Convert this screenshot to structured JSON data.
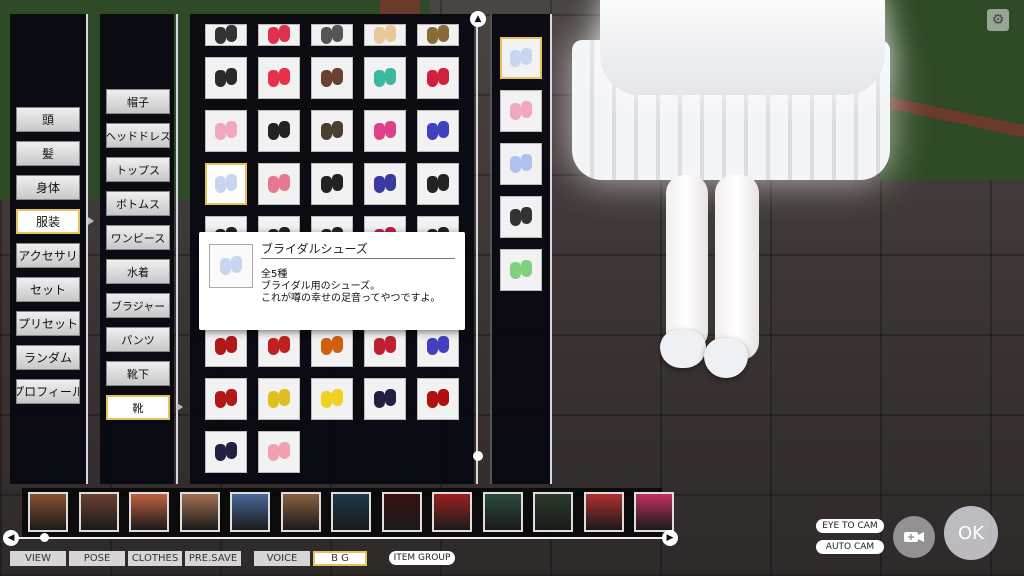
{
  "categories": [
    "頭",
    "髪",
    "身体",
    "服装",
    "アクセサリ",
    "セット",
    "プリセット",
    "ランダム",
    "プロフィール"
  ],
  "selected_category": "服装",
  "subcategories": [
    "帽子",
    "ヘッドドレス",
    "トップス",
    "ボトムス",
    "ワンピース",
    "水着",
    "ブラジャー",
    "パンツ",
    "靴下",
    "靴"
  ],
  "selected_subcategory": "靴",
  "tooltip": {
    "title": "ブライダルシューズ",
    "count": "全5種",
    "desc1": "ブライダル用のシューズ。",
    "desc2": "これが噂の幸せの足音ってやつですよ。"
  },
  "shoe_colors": {
    "row0": [
      "#333333",
      "#e03050",
      "#555555",
      "#e8c89a",
      "#8a6a3a"
    ],
    "row1": [
      "#2a2a2a",
      "#e8304a",
      "#6a4030",
      "#3ab8a0",
      "#d02040"
    ],
    "row2": [
      "#f0a8c0",
      "#222222",
      "#4a4030",
      "#e0408a",
      "#4040c0"
    ],
    "row3": [
      "#c8d4f0",
      "#e87890",
      "#222222",
      "#3a3aa0",
      "#222222"
    ],
    "row4": [
      "#222222",
      "#222222",
      "#222222",
      "#c02040",
      "#222222"
    ],
    "row7": [
      "#b01818",
      "#c02020",
      "#d06010",
      "#c02030",
      "#4040c0"
    ],
    "row8": [
      "#b01818",
      "#e0c020",
      "#f0d020",
      "#202040",
      "#b01010"
    ],
    "row9": [
      "#202040",
      "#f0a0b0"
    ],
    "variants": [
      "#c8d4f0",
      "#f0a8c0",
      "#b0c0f0",
      "#333333",
      "#80d080"
    ]
  },
  "bottom_tabs": [
    "VIEW",
    "POSE",
    "CLOTHES",
    "PRE.SAVE",
    "VOICE",
    "B G"
  ],
  "selected_tab": "B G",
  "item_group": "ITEM GROUP",
  "eye_to_cam": "EYE TO CAM",
  "auto_cam": "AUTO CAM",
  "ok": "OK",
  "icons": {
    "up": "▲",
    "left": "◀",
    "right": "▶",
    "gear": "⚙"
  },
  "thumb_colors": [
    "#8a5030",
    "#6a4030",
    "#c06040",
    "#a07050",
    "#4a6a9a",
    "#8a6040",
    "#1a3a4a",
    "#3a1010",
    "#9a2020",
    "#2a4a3a",
    "#2a3a2a",
    "#b03030",
    "#c03060"
  ],
  "accent": "#e6c35a"
}
